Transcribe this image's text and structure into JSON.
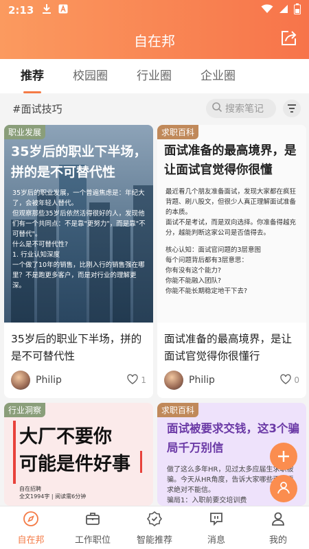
{
  "status_bar": {
    "time": "2:13",
    "icons": [
      "download-icon",
      "a-icon",
      "wifi-icon",
      "signal-icon",
      "battery-icon"
    ]
  },
  "header": {
    "title": "自在邦",
    "share_icon": "share-icon"
  },
  "tabs": [
    {
      "label": "推荐",
      "active": true
    },
    {
      "label": "校园圈",
      "active": false
    },
    {
      "label": "行业圈",
      "active": false
    },
    {
      "label": "企业圈",
      "active": false
    }
  ],
  "filter_bar": {
    "hashtag": "#面试技巧",
    "search_placeholder": "搜索笔记",
    "filter_icon": "filter-icon"
  },
  "cards": [
    {
      "tag": "职业发展",
      "cover_title": "35岁后的职业下半场，拼的是不可替代性",
      "cover_lines": [
        "35岁后的职业发展，一个普遍焦虑是：年纪大了，会被年轻人替代。",
        "但观察那些35岁后依然活得很好的人，发现他们有一个共同点：不是靠\"更努力\"，而是靠\"不可替代\"。",
        "什么是不可替代性?",
        "1. 行业认知深度",
        "一个做了10年的销售，比刚入行的销售强在哪里？不是跑更多客户，而是对行业的理解更深。"
      ],
      "title": "35岁后的职业下半场，拼的是不可替代性",
      "author": "Philip",
      "likes": "1"
    },
    {
      "tag": "求职百科",
      "cover_title": "面试准备的最高境界，是让面试官觉得你很懂",
      "cover_lines": [
        "最近看几个朋友准备面试，发现大家都在疯狂背题、刷八股文，但很少人真正理解面试准备的本质。",
        "面试不是考试，而是双向选择。你准备得越充分，越能判断这家公司是否值得去。",
        "",
        "核心认知：面试官问题的3层意图",
        "每个问题背后都有3层意思：",
        "你有没有这个能力?",
        "你能不能融入团队?",
        "你能不能长期稳定地干下去?"
      ],
      "title": "面试准备的最高境界，是让面试官觉得你很懂行",
      "author": "Philip",
      "likes": "0"
    },
    {
      "tag": "行业洞察",
      "poster_title_1": "大厂不要你",
      "poster_title_2": "可能是件好事",
      "poster_meta_1": "自在招聘",
      "poster_meta_2": "全文1994字 | 阅读需6分钟"
    },
    {
      "tag": "求职百科",
      "poster_title": "面试被要求交钱，这3个骗局千万别信",
      "poster_lines": [
        "做了这么多年HR，见过太多应届生求职被骗。今天从HR角度，告诉大家哪些面试要求绝对不能信。",
        "骗局1：入职前要交培训费"
      ]
    }
  ],
  "fabs": [
    "add-icon",
    "user-icon"
  ],
  "bottom_nav": [
    {
      "label": "自在邦",
      "icon": "compass-icon",
      "active": true
    },
    {
      "label": "工作职位",
      "icon": "briefcase-icon",
      "active": false
    },
    {
      "label": "智能推荐",
      "icon": "badge-check-icon",
      "active": false
    },
    {
      "label": "消息",
      "icon": "message-icon",
      "active": false
    },
    {
      "label": "我的",
      "icon": "person-icon",
      "active": false
    }
  ],
  "colors": {
    "accent": "#f47a45",
    "header_gradient_start": "#fb9a5f",
    "header_gradient_end": "#f7744a"
  }
}
